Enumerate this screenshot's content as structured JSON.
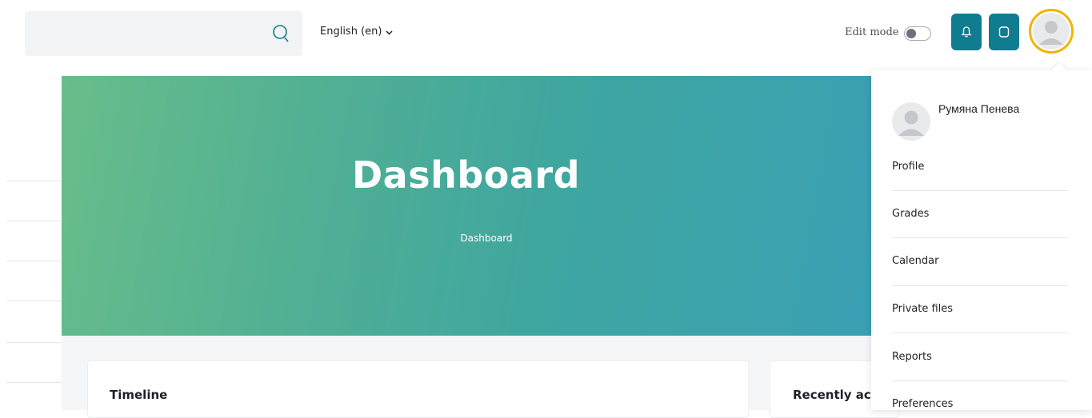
{
  "header": {
    "search": {
      "placeholder": "",
      "value": ""
    },
    "language": "English (en)",
    "edit_mode_label": "Edit mode",
    "edit_mode_on": false,
    "notifications_icon": "bell-icon",
    "messages_icon": "chat-bubble-icon",
    "avatar_icon": "user-avatar-icon",
    "accent_color": "#0f7c90",
    "avatar_ring_color": "#f0b400"
  },
  "hero": {
    "title": "Dashboard",
    "breadcrumb": "Dashboard",
    "gradient_colors": [
      "#68bd8a",
      "#3aa0b4"
    ]
  },
  "main": {
    "timeline_title": "Timeline",
    "recent_title": "Recently acc"
  },
  "user_menu": {
    "user_name": "Румяна Пенева",
    "items": [
      {
        "label": "Profile"
      },
      {
        "label": "Grades"
      },
      {
        "label": "Calendar"
      },
      {
        "label": "Private files"
      },
      {
        "label": "Reports"
      },
      {
        "label": "Preferences"
      }
    ]
  }
}
